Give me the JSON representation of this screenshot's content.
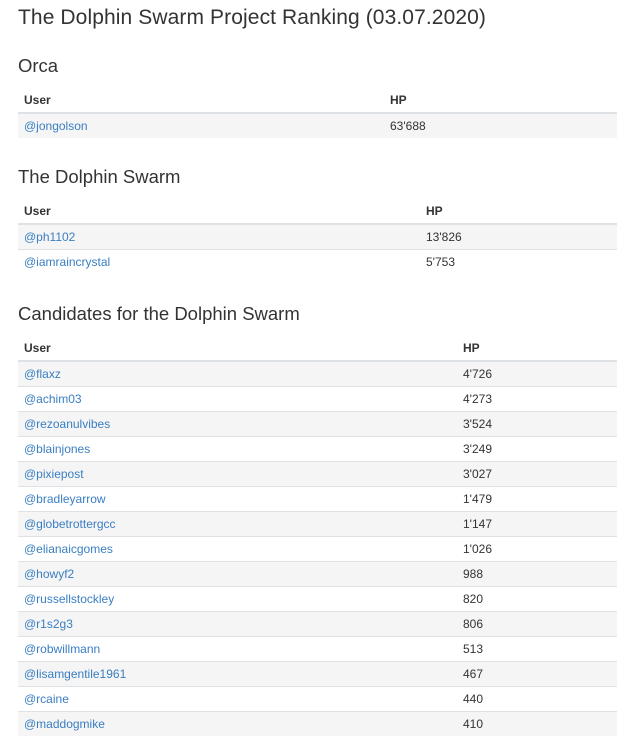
{
  "title": "The Dolphin Swarm Project Ranking (03.07.2020)",
  "colors": {
    "link": "#3a7ec2",
    "text": "#333333",
    "stripe": "#f5f5f5",
    "border": "#dee2e6"
  },
  "sections": [
    {
      "title": "Orca",
      "headers": {
        "user": "User",
        "hp": "HP"
      },
      "rows": [
        {
          "user": "@jongolson",
          "hp": "63'688"
        }
      ]
    },
    {
      "title": "The Dolphin Swarm",
      "headers": {
        "user": "User",
        "hp": "HP"
      },
      "rows": [
        {
          "user": "@ph1102",
          "hp": "13'826"
        },
        {
          "user": "@iamraincrystal",
          "hp": "5'753"
        }
      ]
    },
    {
      "title": "Candidates for the Dolphin Swarm",
      "headers": {
        "user": "User",
        "hp": "HP"
      },
      "rows": [
        {
          "user": "@flaxz",
          "hp": "4'726"
        },
        {
          "user": "@achim03",
          "hp": "4'273"
        },
        {
          "user": "@rezoanulvibes",
          "hp": "3'524"
        },
        {
          "user": "@blainjones",
          "hp": "3'249"
        },
        {
          "user": "@pixiepost",
          "hp": "3'027"
        },
        {
          "user": "@bradleyarrow",
          "hp": "1'479"
        },
        {
          "user": "@globetrottergcc",
          "hp": "1'147"
        },
        {
          "user": "@elianaicgomes",
          "hp": "1'026"
        },
        {
          "user": "@howyf2",
          "hp": "988"
        },
        {
          "user": "@russellstockley",
          "hp": "820"
        },
        {
          "user": "@r1s2g3",
          "hp": "806"
        },
        {
          "user": "@robwillmann",
          "hp": "513"
        },
        {
          "user": "@lisamgentile1961",
          "hp": "467"
        },
        {
          "user": "@rcaine",
          "hp": "440"
        },
        {
          "user": "@maddogmike",
          "hp": "410"
        }
      ]
    }
  ]
}
